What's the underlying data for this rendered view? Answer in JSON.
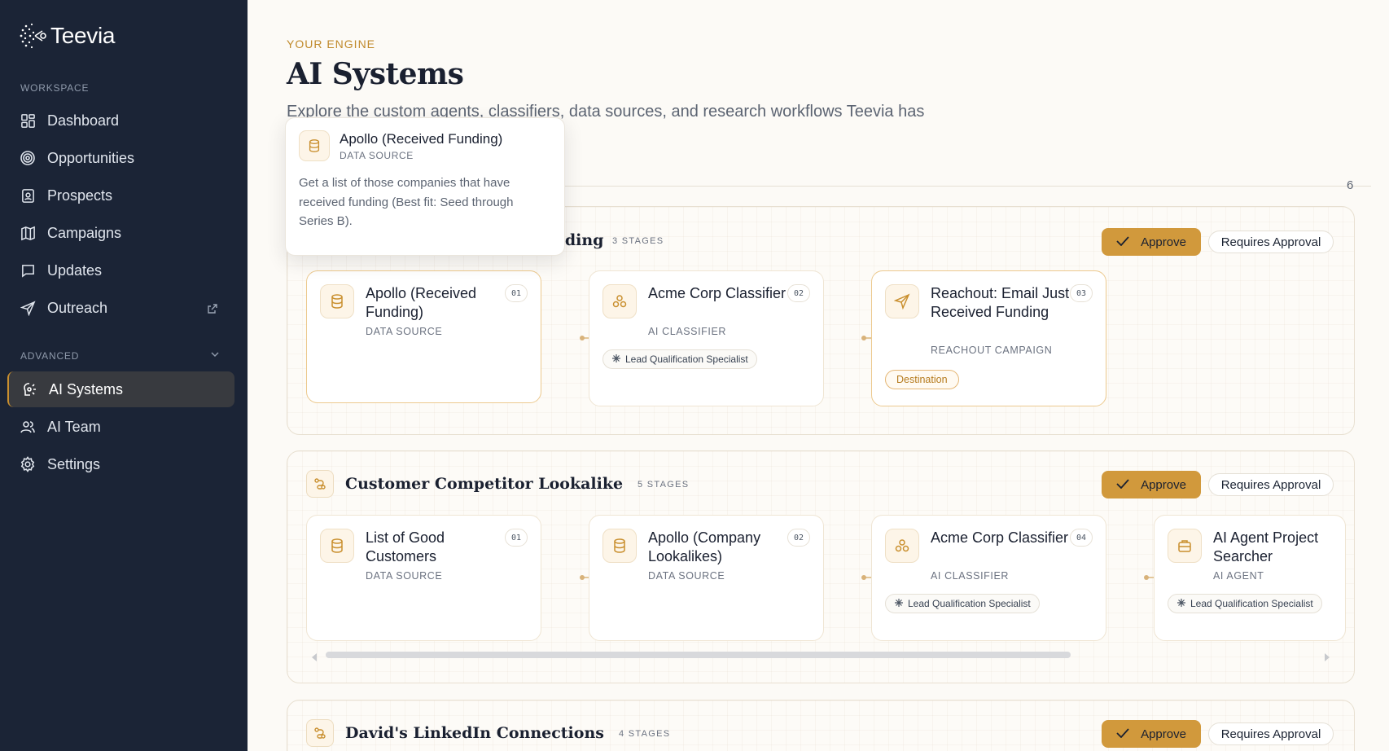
{
  "app": {
    "name": "Teevia"
  },
  "sidebar": {
    "workspace_label": "WORKSPACE",
    "items": [
      {
        "label": "Dashboard",
        "icon": "grid-icon"
      },
      {
        "label": "Opportunities",
        "icon": "target-icon"
      },
      {
        "label": "Prospects",
        "icon": "id-card-icon"
      },
      {
        "label": "Campaigns",
        "icon": "map-icon"
      },
      {
        "label": "Updates",
        "icon": "message-icon"
      },
      {
        "label": "Outreach",
        "icon": "send-icon"
      }
    ],
    "advanced_label": "ADVANCED",
    "advanced_items": [
      {
        "label": "AI Systems",
        "icon": "brain-icon",
        "active": true
      },
      {
        "label": "AI Team",
        "icon": "users-icon"
      },
      {
        "label": "Settings",
        "icon": "gear-icon"
      }
    ]
  },
  "header": {
    "eyebrow": "YOUR ENGINE",
    "title": "AI Systems",
    "description": "Explore the custom agents, classifiers, data sources, and research workflows Teevia has",
    "count": "6"
  },
  "buttons": {
    "approve": "Approve",
    "requires_approval": "Requires Approval"
  },
  "workflows": [
    {
      "name": "Apollo (Received Funding)",
      "name_visible_suffix": "nding",
      "stages_label": "3 STAGES",
      "stages": [
        {
          "num": "01",
          "name": "Apollo (Received Funding)",
          "type": "DATA SOURCE",
          "icon": "database-icon"
        },
        {
          "num": "02",
          "name": "Acme Corp Classifier",
          "type": "AI CLASSIFIER",
          "icon": "classifier-icon",
          "tag": "Lead Qualification Specialist"
        },
        {
          "num": "03",
          "name": "Reachout: Email Just Received Funding",
          "type": "REACHOUT CAMPAIGN",
          "icon": "send-icon",
          "badge": "Destination"
        }
      ]
    },
    {
      "name": "Customer Competitor Lookalike",
      "stages_label": "5 STAGES",
      "stages": [
        {
          "num": "01",
          "name": "List of Good Customers",
          "type": "DATA SOURCE",
          "icon": "database-icon"
        },
        {
          "num": "02",
          "name": "Apollo (Company Lookalikes)",
          "type": "DATA SOURCE",
          "icon": "database-icon"
        },
        {
          "num": "04",
          "name": "Acme Corp Classifier",
          "type": "AI CLASSIFIER",
          "icon": "classifier-icon",
          "tag": "Lead Qualification Specialist"
        },
        {
          "name": "AI Agent Project Searcher",
          "type": "AI AGENT",
          "icon": "briefcase-icon",
          "tag": "Lead Qualification Specialist"
        }
      ]
    },
    {
      "name": "David's LinkedIn Connections",
      "stages_label": "4 STAGES"
    }
  ],
  "tooltip": {
    "title": "Apollo (Received Funding)",
    "type": "DATA SOURCE",
    "description": "Get a list of those companies that have received funding (Best fit: Seed through Series B)."
  },
  "colors": {
    "accent": "#d1993c",
    "sidebar_bg": "#1b2436",
    "page_bg": "#fcfaf6"
  }
}
